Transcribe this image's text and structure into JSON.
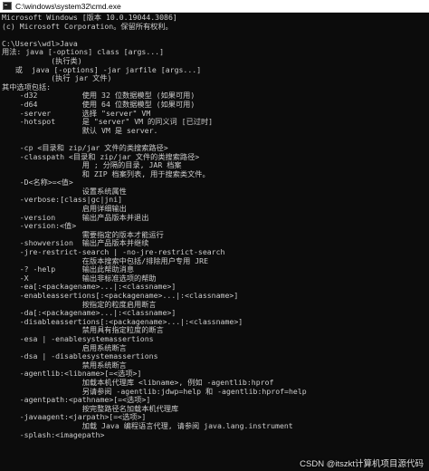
{
  "window": {
    "title": "C:\\windows\\system32\\cmd.exe",
    "icon": "cmd-prompt-icon"
  },
  "console": {
    "lines": [
      "Microsoft Windows [版本 10.0.19044.3086]",
      "(c) Microsoft Corporation。保留所有权利。",
      "",
      "C:\\Users\\wdl>Java",
      "用法: java [-options] class [args...]",
      "           (执行类)",
      "   或  java [-options] -jar jarfile [args...]",
      "           (执行 jar 文件)",
      "其中选项包括:",
      "    -d32          使用 32 位数据模型 (如果可用)",
      "    -d64          使用 64 位数据模型 (如果可用)",
      "    -server       选择 \"server\" VM",
      "    -hotspot      是 \"server\" VM 的同义词 [已过时]",
      "                  默认 VM 是 server.",
      "",
      "    -cp <目录和 zip/jar 文件的类搜索路径>",
      "    -classpath <目录和 zip/jar 文件的类搜索路径>",
      "                  用 ; 分隔的目录, JAR 档案",
      "                  和 ZIP 档案列表, 用于搜索类文件。",
      "    -D<名称>=<值>",
      "                  设置系统属性",
      "    -verbose:[class|gc|jni]",
      "                  启用详细输出",
      "    -version      输出产品版本并退出",
      "    -version:<值>",
      "                  需要指定的版本才能运行",
      "    -showversion  输出产品版本并继续",
      "    -jre-restrict-search | -no-jre-restrict-search",
      "                  在版本搜索中包括/排除用户专用 JRE",
      "    -? -help      输出此帮助消息",
      "    -X            输出非标准选项的帮助",
      "    -ea[:<packagename>...|:<classname>]",
      "    -enableassertions[:<packagename>...|:<classname>]",
      "                  按指定的粒度启用断言",
      "    -da[:<packagename>...|:<classname>]",
      "    -disableassertions[:<packagename>...|:<classname>]",
      "                  禁用具有指定粒度的断言",
      "    -esa | -enablesystemassertions",
      "                  启用系统断言",
      "    -dsa | -disablesystemassertions",
      "                  禁用系统断言",
      "    -agentlib:<libname>[=<选项>]",
      "                  加载本机代理库 <libname>, 例如 -agentlib:hprof",
      "                  另请参阅 -agentlib:jdwp=help 和 -agentlib:hprof=help",
      "    -agentpath:<pathname>[=<选项>]",
      "                  按完整路径名加载本机代理库",
      "    -javaagent:<jarpath>[=<选项>]",
      "                  加载 Java 编程语言代理, 请参阅 java.lang.instrument",
      "    -splash:<imagepath>"
    ]
  },
  "watermark": {
    "text": "CSDN @itszkt计算机项目源代码"
  }
}
